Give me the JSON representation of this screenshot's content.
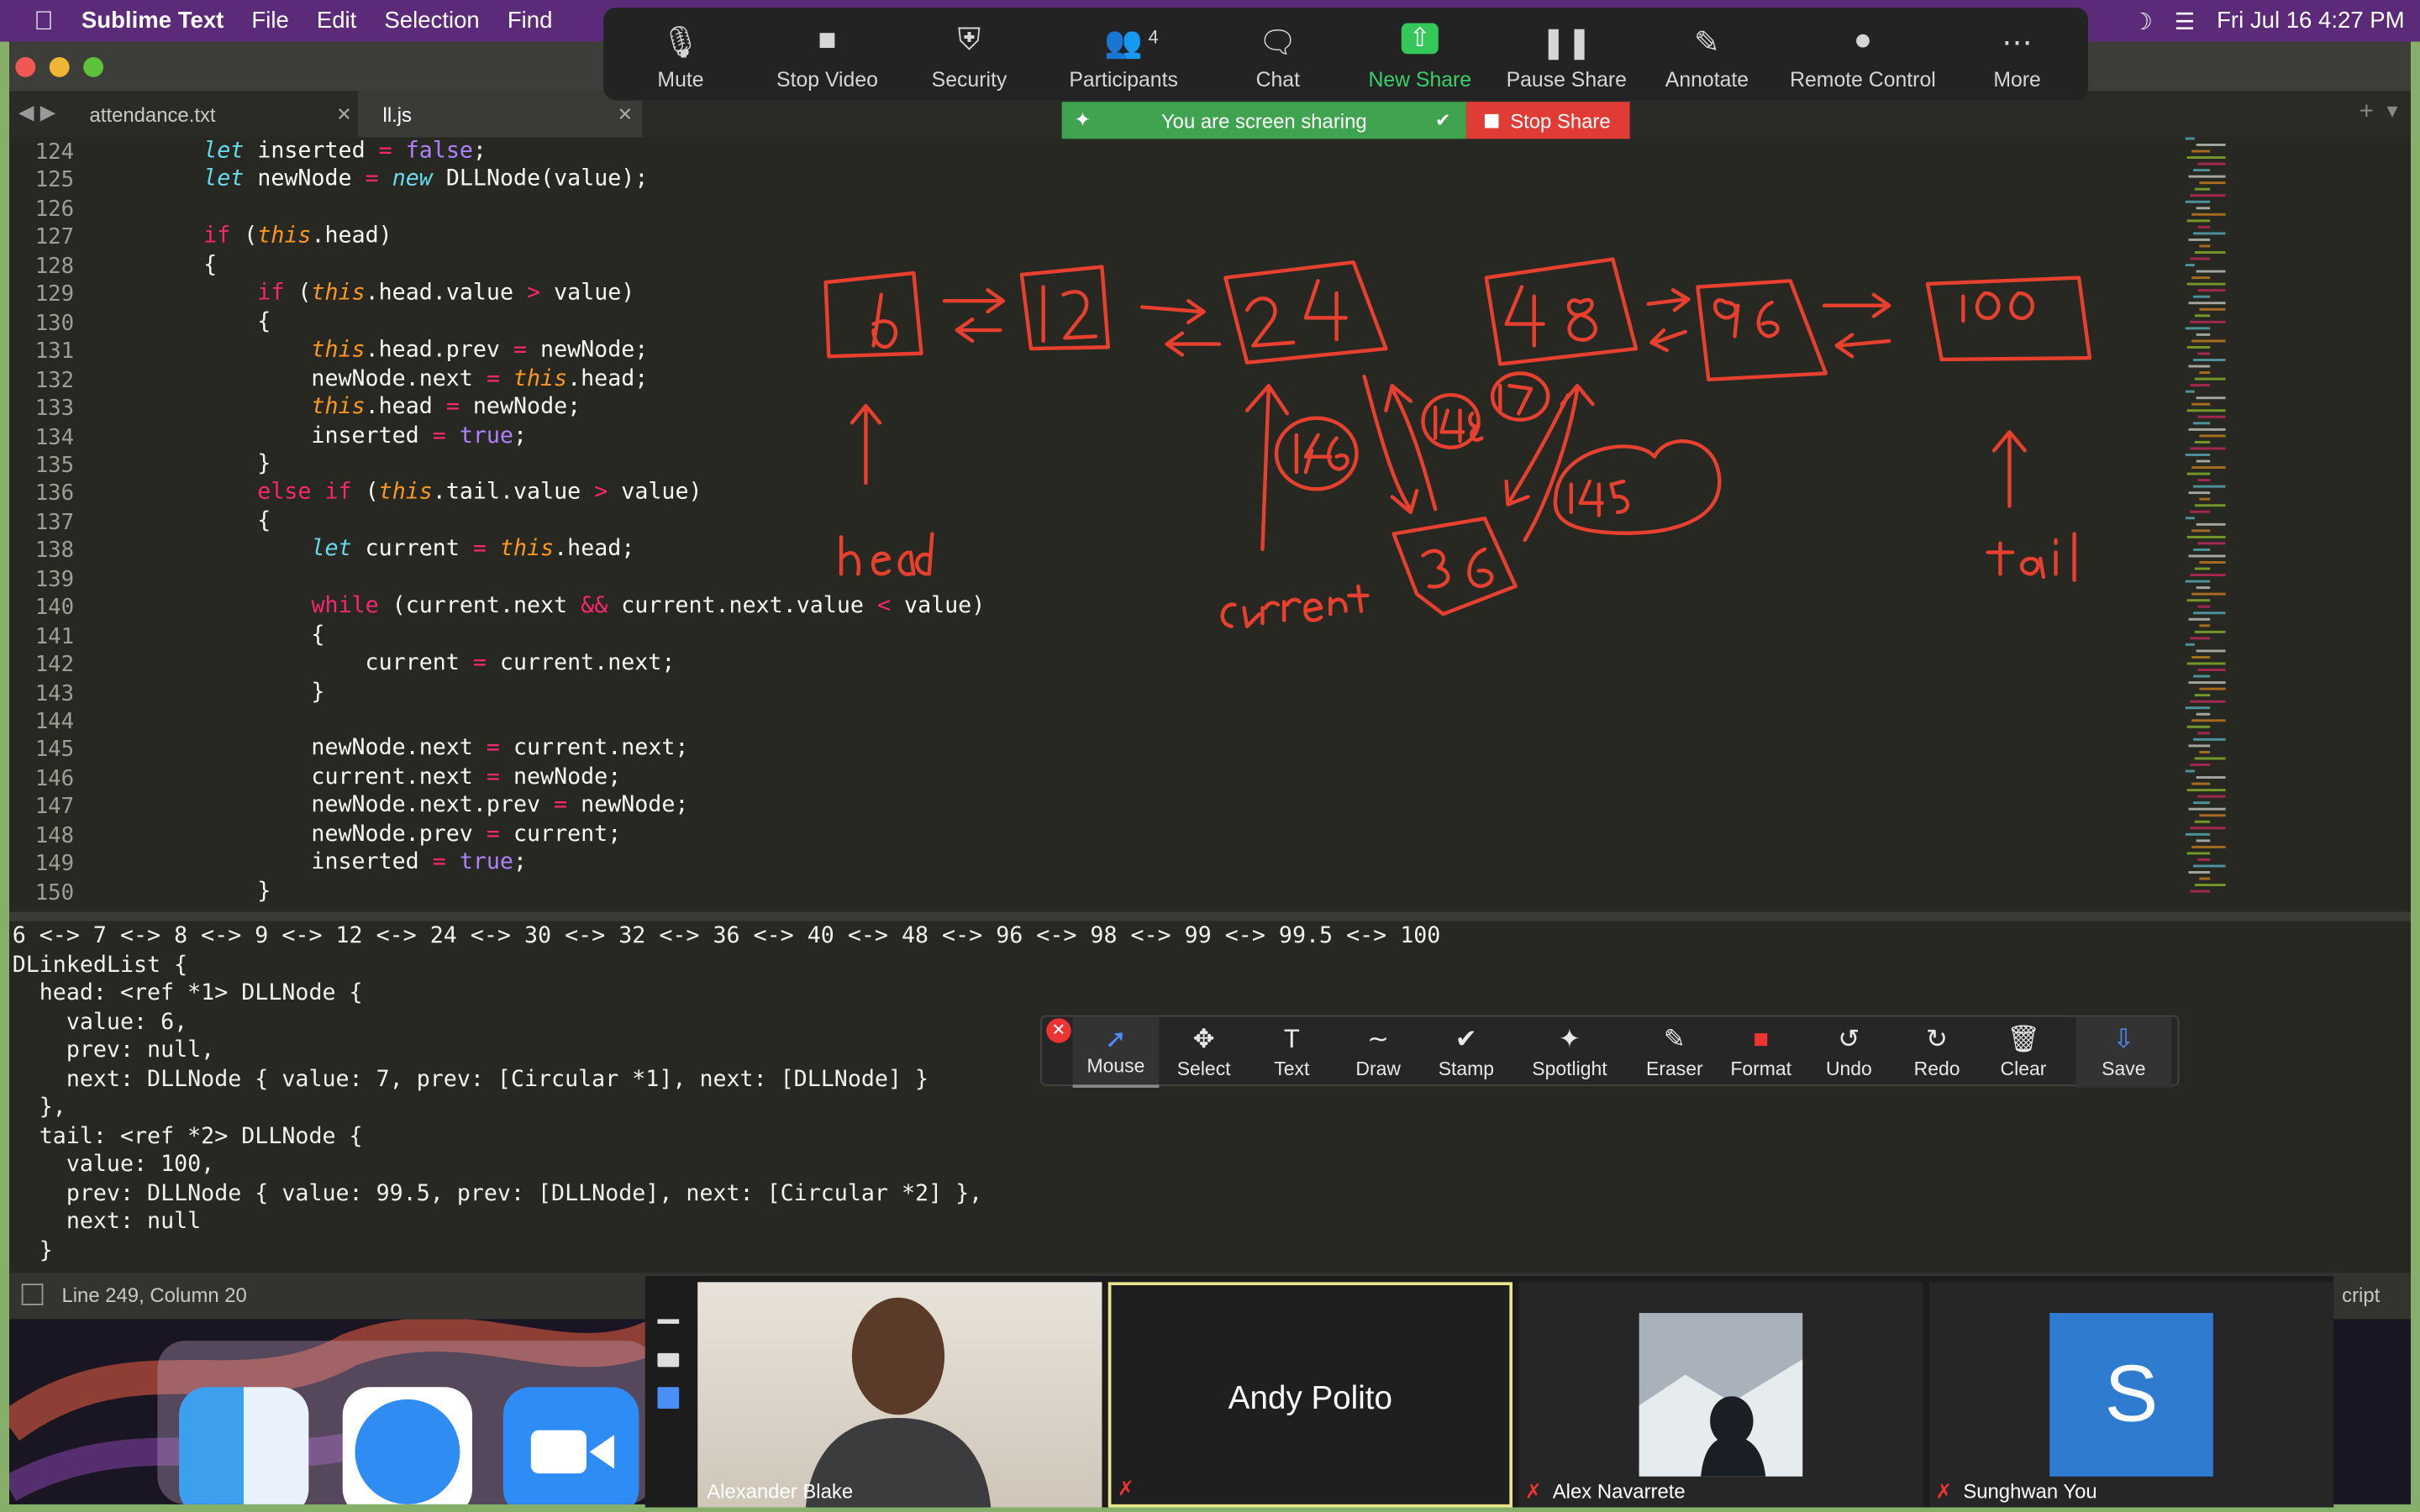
{
  "menubar": {
    "app": "Sublime Text",
    "items": [
      "File",
      "Edit",
      "Selection",
      "Find"
    ],
    "clock": "Fri Jul 16  4:27 PM"
  },
  "tabs": [
    {
      "label": "attendance.txt",
      "active": false
    },
    {
      "label": "ll.js",
      "active": true
    }
  ],
  "editor": {
    "lines": [
      {
        "n": "124",
        "t": "        let inserted = false;"
      },
      {
        "n": "125",
        "t": "        let newNode = new DLLNode(value);"
      },
      {
        "n": "126",
        "t": ""
      },
      {
        "n": "127",
        "t": "        if (this.head)"
      },
      {
        "n": "128",
        "t": "        {"
      },
      {
        "n": "129",
        "t": "            if (this.head.value > value)"
      },
      {
        "n": "130",
        "t": "            {"
      },
      {
        "n": "131",
        "t": "                this.head.prev = newNode;"
      },
      {
        "n": "132",
        "t": "                newNode.next = this.head;"
      },
      {
        "n": "133",
        "t": "                this.head = newNode;"
      },
      {
        "n": "134",
        "t": "                inserted = true;"
      },
      {
        "n": "135",
        "t": "            }"
      },
      {
        "n": "136",
        "t": "            else if (this.tail.value > value)"
      },
      {
        "n": "137",
        "t": "            {"
      },
      {
        "n": "138",
        "t": "                let current = this.head;"
      },
      {
        "n": "139",
        "t": ""
      },
      {
        "n": "140",
        "t": "                while (current.next && current.next.value < value)"
      },
      {
        "n": "141",
        "t": "                {"
      },
      {
        "n": "142",
        "t": "                    current = current.next;"
      },
      {
        "n": "143",
        "t": "                }"
      },
      {
        "n": "144",
        "t": ""
      },
      {
        "n": "145",
        "t": "                newNode.next = current.next;"
      },
      {
        "n": "146",
        "t": "                current.next = newNode;"
      },
      {
        "n": "147",
        "t": "                newNode.next.prev = newNode;"
      },
      {
        "n": "148",
        "t": "                newNode.prev = current;"
      },
      {
        "n": "149",
        "t": "                inserted = true;"
      },
      {
        "n": "150",
        "t": "            }"
      }
    ]
  },
  "console": {
    "lines": [
      "6 <-> 7 <-> 8 <-> 9 <-> 12 <-> 24 <-> 30 <-> 32 <-> 36 <-> 40 <-> 48 <-> 96 <-> 98 <-> 99 <-> 99.5 <-> 100",
      "DLinkedList {",
      "  head: <ref *1> DLLNode {",
      "    value: 6,",
      "    prev: null,",
      "    next: DLLNode { value: 7, prev: [Circular *1], next: [DLLNode] }",
      "  },",
      "  tail: <ref *2> DLLNode {",
      "    value: 100,",
      "    prev: DLLNode { value: 99.5, prev: [DLLNode], next: [Circular *2] },",
      "    next: null",
      "  }"
    ]
  },
  "statusbar": {
    "position": "Line 249, Column 20",
    "syntax_fragment": "cript"
  },
  "zoom_toolbar": {
    "items": [
      {
        "label": "Mute",
        "icon": "microphone-icon"
      },
      {
        "label": "Stop Video",
        "icon": "video-camera-icon"
      },
      {
        "label": "Security",
        "icon": "shield-icon"
      },
      {
        "label": "Participants",
        "icon": "participants-icon",
        "count": "4"
      },
      {
        "label": "Chat",
        "icon": "chat-bubble-icon"
      },
      {
        "label": "New Share",
        "icon": "share-arrow-icon"
      },
      {
        "label": "Pause Share",
        "icon": "pause-icon"
      },
      {
        "label": "Annotate",
        "icon": "pencil-icon"
      },
      {
        "label": "Remote Control",
        "icon": "mouse-icon"
      },
      {
        "label": "More",
        "icon": "ellipsis-icon"
      }
    ],
    "sharing_text": "You are screen sharing",
    "stop_share": "Stop Share"
  },
  "annotate_toolbar": {
    "items": [
      {
        "label": "Mouse",
        "icon": "cursor-icon"
      },
      {
        "label": "Select",
        "icon": "move-icon"
      },
      {
        "label": "Text",
        "icon": "text-icon"
      },
      {
        "label": "Draw",
        "icon": "squiggle-icon"
      },
      {
        "label": "Stamp",
        "icon": "checkmark-icon"
      },
      {
        "label": "Spotlight",
        "icon": "wand-icon"
      },
      {
        "label": "Eraser",
        "icon": "eraser-icon"
      },
      {
        "label": "Format",
        "icon": "color-square-icon"
      },
      {
        "label": "Undo",
        "icon": "undo-icon"
      },
      {
        "label": "Redo",
        "icon": "redo-icon"
      },
      {
        "label": "Clear",
        "icon": "trash-icon"
      },
      {
        "label": "Save",
        "icon": "save-icon"
      }
    ]
  },
  "participants": [
    {
      "name": "Alexander Blake",
      "kind": "video"
    },
    {
      "name": "Andy Polito",
      "kind": "name-only"
    },
    {
      "name": "Alex Navarrete",
      "kind": "photo"
    },
    {
      "name": "Sunghwan You",
      "kind": "avatar",
      "initial": "S"
    }
  ],
  "drawing": {
    "nodes": [
      "6",
      "12",
      "24",
      "48",
      "96",
      "100",
      "146",
      "148",
      "147",
      "145",
      "36"
    ],
    "labels": [
      "head",
      "current",
      "tail"
    ],
    "ink_color": "#e8402f"
  },
  "colors": {
    "keyword": "#66d9ef",
    "this": "#fd971f",
    "string_bool": "#ae81ff",
    "operator": "#f92672"
  }
}
